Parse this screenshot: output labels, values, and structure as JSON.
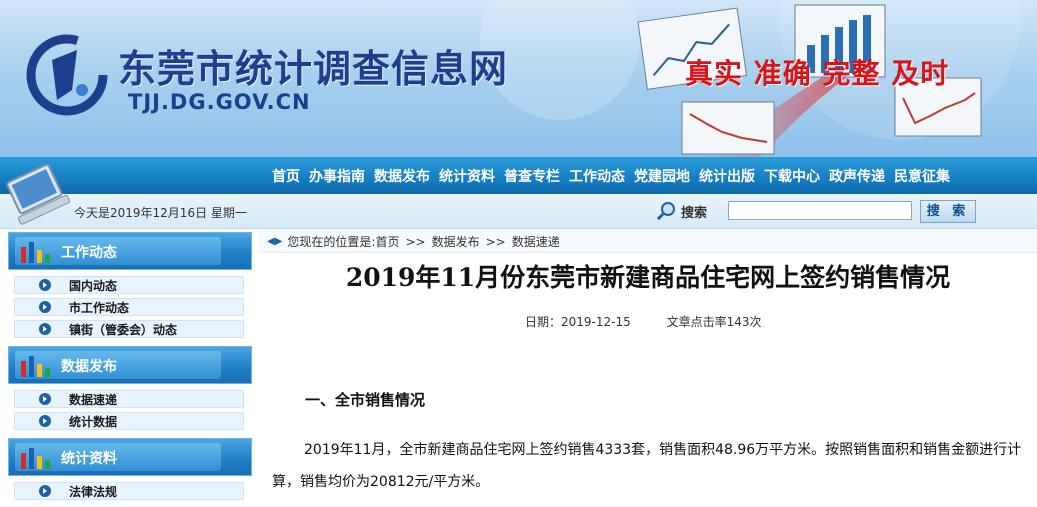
{
  "header": {
    "site_title": "东莞市统计调查信息网",
    "site_domain": "TJJ.DG.GOV.CN",
    "slogan": "真实 准确 完整 及时"
  },
  "nav": {
    "items": [
      "首页",
      "办事指南",
      "数据发布",
      "统计资料",
      "普查专栏",
      "工作动态",
      "党建园地",
      "统计出版",
      "下载中心",
      "政声传递",
      "民意征集"
    ]
  },
  "subbar": {
    "today": "今天是2019年12月16日 星期一",
    "search_label": "搜索",
    "search_value": "",
    "search_button": "搜 索"
  },
  "sidebar": {
    "sections": [
      {
        "title": "工作动态",
        "items": [
          "国内动态",
          "市工作动态",
          "镇街（管委会）动态"
        ]
      },
      {
        "title": "数据发布",
        "items": [
          "数据速递",
          "统计数据"
        ]
      },
      {
        "title": "统计资料",
        "items": [
          "法律法规"
        ]
      }
    ]
  },
  "breadcrumb": {
    "prefix": "您现在的位置是:",
    "items": [
      "首页",
      "数据发布",
      "数据速递"
    ],
    "separator": ">>"
  },
  "article": {
    "title": "2019年11月份东莞市新建商品住宅网上签约销售情况",
    "date": "日期：2019-12-15",
    "hits": "文章点击率143次",
    "section1_heading": "一、全市销售情况",
    "para1": "2019年11月，全市新建商品住宅网上签约销售4333套，销售面积48.96万平方米。按照销售面积和销售金额进行计算，销售均价为20812元/平方米。"
  },
  "colors": {
    "nav_bg": "#1780c4",
    "title_blue": "#1c3f8f",
    "slogan_red": "#d81418",
    "sidebar_head": "#1e7ec6"
  }
}
